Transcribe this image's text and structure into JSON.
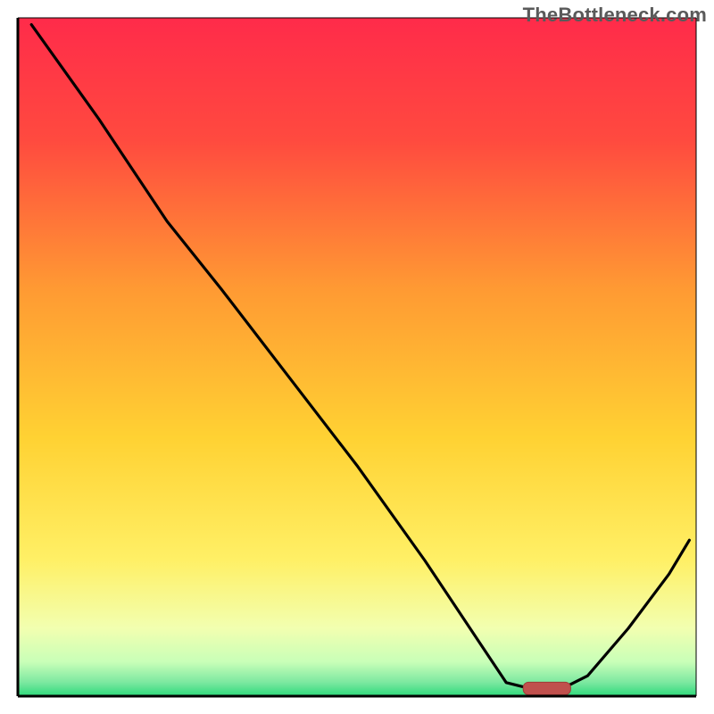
{
  "watermark": "TheBottleneck.com",
  "chart_data": {
    "type": "line",
    "title": "",
    "xlabel": "",
    "ylabel": "",
    "xlim": [
      0,
      100
    ],
    "ylim": [
      0,
      100
    ],
    "background_gradient": {
      "top": "#ff2b4a",
      "mid_upper": "#ff9a33",
      "mid": "#ffe633",
      "mid_lower": "#f5ff8a",
      "bottom": "#2dd97a"
    },
    "curve_points": [
      {
        "x": 2,
        "y": 99
      },
      {
        "x": 12,
        "y": 85
      },
      {
        "x": 22,
        "y": 70
      },
      {
        "x": 30,
        "y": 60
      },
      {
        "x": 40,
        "y": 47
      },
      {
        "x": 50,
        "y": 34
      },
      {
        "x": 60,
        "y": 20
      },
      {
        "x": 68,
        "y": 8
      },
      {
        "x": 72,
        "y": 2
      },
      {
        "x": 76,
        "y": 1
      },
      {
        "x": 80,
        "y": 1
      },
      {
        "x": 84,
        "y": 3
      },
      {
        "x": 90,
        "y": 10
      },
      {
        "x": 96,
        "y": 18
      },
      {
        "x": 99,
        "y": 23
      }
    ],
    "marker": {
      "x_center": 78,
      "width": 7,
      "y": 1,
      "color": "#c0504d"
    },
    "grid": false,
    "legend": false,
    "axes_visible": {
      "x": true,
      "y": true
    },
    "annotations": []
  }
}
